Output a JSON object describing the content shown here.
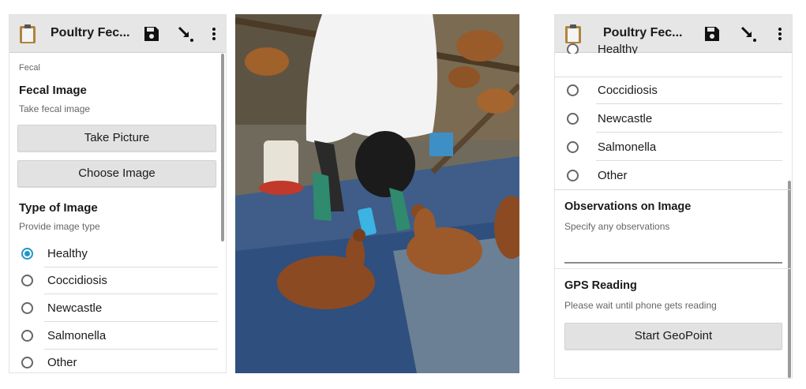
{
  "app": {
    "title": "Poultry Fec..."
  },
  "left": {
    "group_label": "Fecal",
    "fecal_image": {
      "label": "Fecal Image",
      "hint": "Take fecal image",
      "take_picture": "Take Picture",
      "choose_image": "Choose Image"
    },
    "type_of_image": {
      "label": "Type of Image",
      "hint": "Provide image type",
      "selected": "Healthy",
      "options": [
        "Healthy",
        "Coccidiosis",
        "Newcastle",
        "Salmonella",
        "Other"
      ]
    }
  },
  "right": {
    "partial_option": "Healthy",
    "options": [
      "Coccidiosis",
      "Newcastle",
      "Salmonella",
      "Other"
    ],
    "observations": {
      "label": "Observations on Image",
      "hint": "Specify any observations",
      "value": ""
    },
    "gps": {
      "label": "GPS Reading",
      "hint": "Please wait until phone gets reading",
      "button": "Start GeoPoint"
    }
  },
  "colors": {
    "accent": "#2196c9",
    "appbar": "#e6e6e6",
    "button": "#e2e2e2"
  },
  "icons": [
    "clipboard-icon",
    "save-icon",
    "download-arrow-icon",
    "more-vert-icon"
  ]
}
